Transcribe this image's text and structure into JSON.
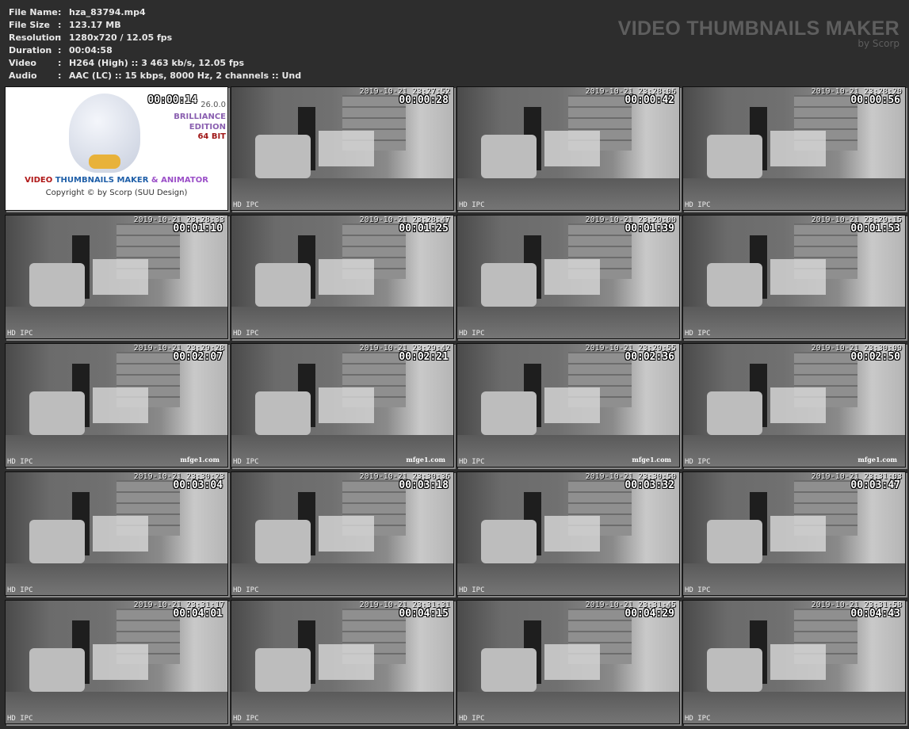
{
  "info": [
    {
      "key": "File Name",
      "value": "hza_83794.mp4"
    },
    {
      "key": "File Size",
      "value": "123.17 MB"
    },
    {
      "key": "Resolution",
      "value": "1280x720 / 12.05 fps"
    },
    {
      "key": "Duration",
      "value": "00:04:58"
    },
    {
      "key": "Video",
      "value": "H264 (High) :: 3 463 kb/s, 12.05 fps"
    },
    {
      "key": "Audio",
      "value": "AAC (LC) :: 15 kbps, 8000 Hz, 2 channels :: Und"
    }
  ],
  "separator": ":",
  "brand": {
    "title": "VIDEO THUMBNAILS MAKER",
    "byline": "by Scorp"
  },
  "logo_tile": {
    "timecode": "00:00:14",
    "version": "26.0.0",
    "edition_line1": "BRILLIANCE",
    "edition_line2": "EDITION",
    "bits": "64 BIT",
    "title_parts": [
      {
        "text": "VIDEO ",
        "color": "#b01818"
      },
      {
        "text": "THUMBNAILS MAKER ",
        "color": "#1f5fa8"
      },
      {
        "text": "& ANIMATOR",
        "color": "#9b4fc8"
      }
    ],
    "copyright": "Copyright © by Scorp (SUU Design)"
  },
  "camera_label": "HD  IPC",
  "thumbnails": [
    {
      "date": "2019-10-21 23:27:52",
      "timecode": "00:00:28"
    },
    {
      "date": "2019-10-21 23:28:06",
      "timecode": "00:00:42"
    },
    {
      "date": "2019-10-21 23:28:20",
      "timecode": "00:00:56"
    },
    {
      "date": "2019-10-21 23:28:33",
      "timecode": "00:01:10"
    },
    {
      "date": "2019-10-21 23:28:47",
      "timecode": "00:01:25"
    },
    {
      "date": "2019-10-21 23:29:00",
      "timecode": "00:01:39"
    },
    {
      "date": "2019-10-21 23:29:15",
      "timecode": "00:01:53"
    },
    {
      "date": "2019-10-21 23:29:28",
      "timecode": "00:02:07",
      "watermark": "mfge1.com"
    },
    {
      "date": "2019-10-21 23:29:42",
      "timecode": "00:02:21",
      "watermark": "mfge1.com"
    },
    {
      "date": "2019-10-21 23:29:55",
      "timecode": "00:02:36",
      "watermark": "mfge1.com"
    },
    {
      "date": "2019-10-21 23:30:09",
      "timecode": "00:02:50",
      "watermark": "mfge1.com"
    },
    {
      "date": "2019-10-21 23:30:23",
      "timecode": "00:03:04"
    },
    {
      "date": "2019-10-21 23:30:36",
      "timecode": "00:03:18"
    },
    {
      "date": "2019-10-21 23:30:50",
      "timecode": "00:03:32"
    },
    {
      "date": "2019-10-21 23:31:03",
      "timecode": "00:03:47"
    },
    {
      "date": "2019-10-21 23:31:17",
      "timecode": "00:04:01"
    },
    {
      "date": "2019-10-21 23:31:31",
      "timecode": "00:04:15"
    },
    {
      "date": "2019-10-21 23:31:45",
      "timecode": "00:04:29"
    },
    {
      "date": "2019-10-21 23:31:58",
      "timecode": "00:04:43"
    }
  ]
}
